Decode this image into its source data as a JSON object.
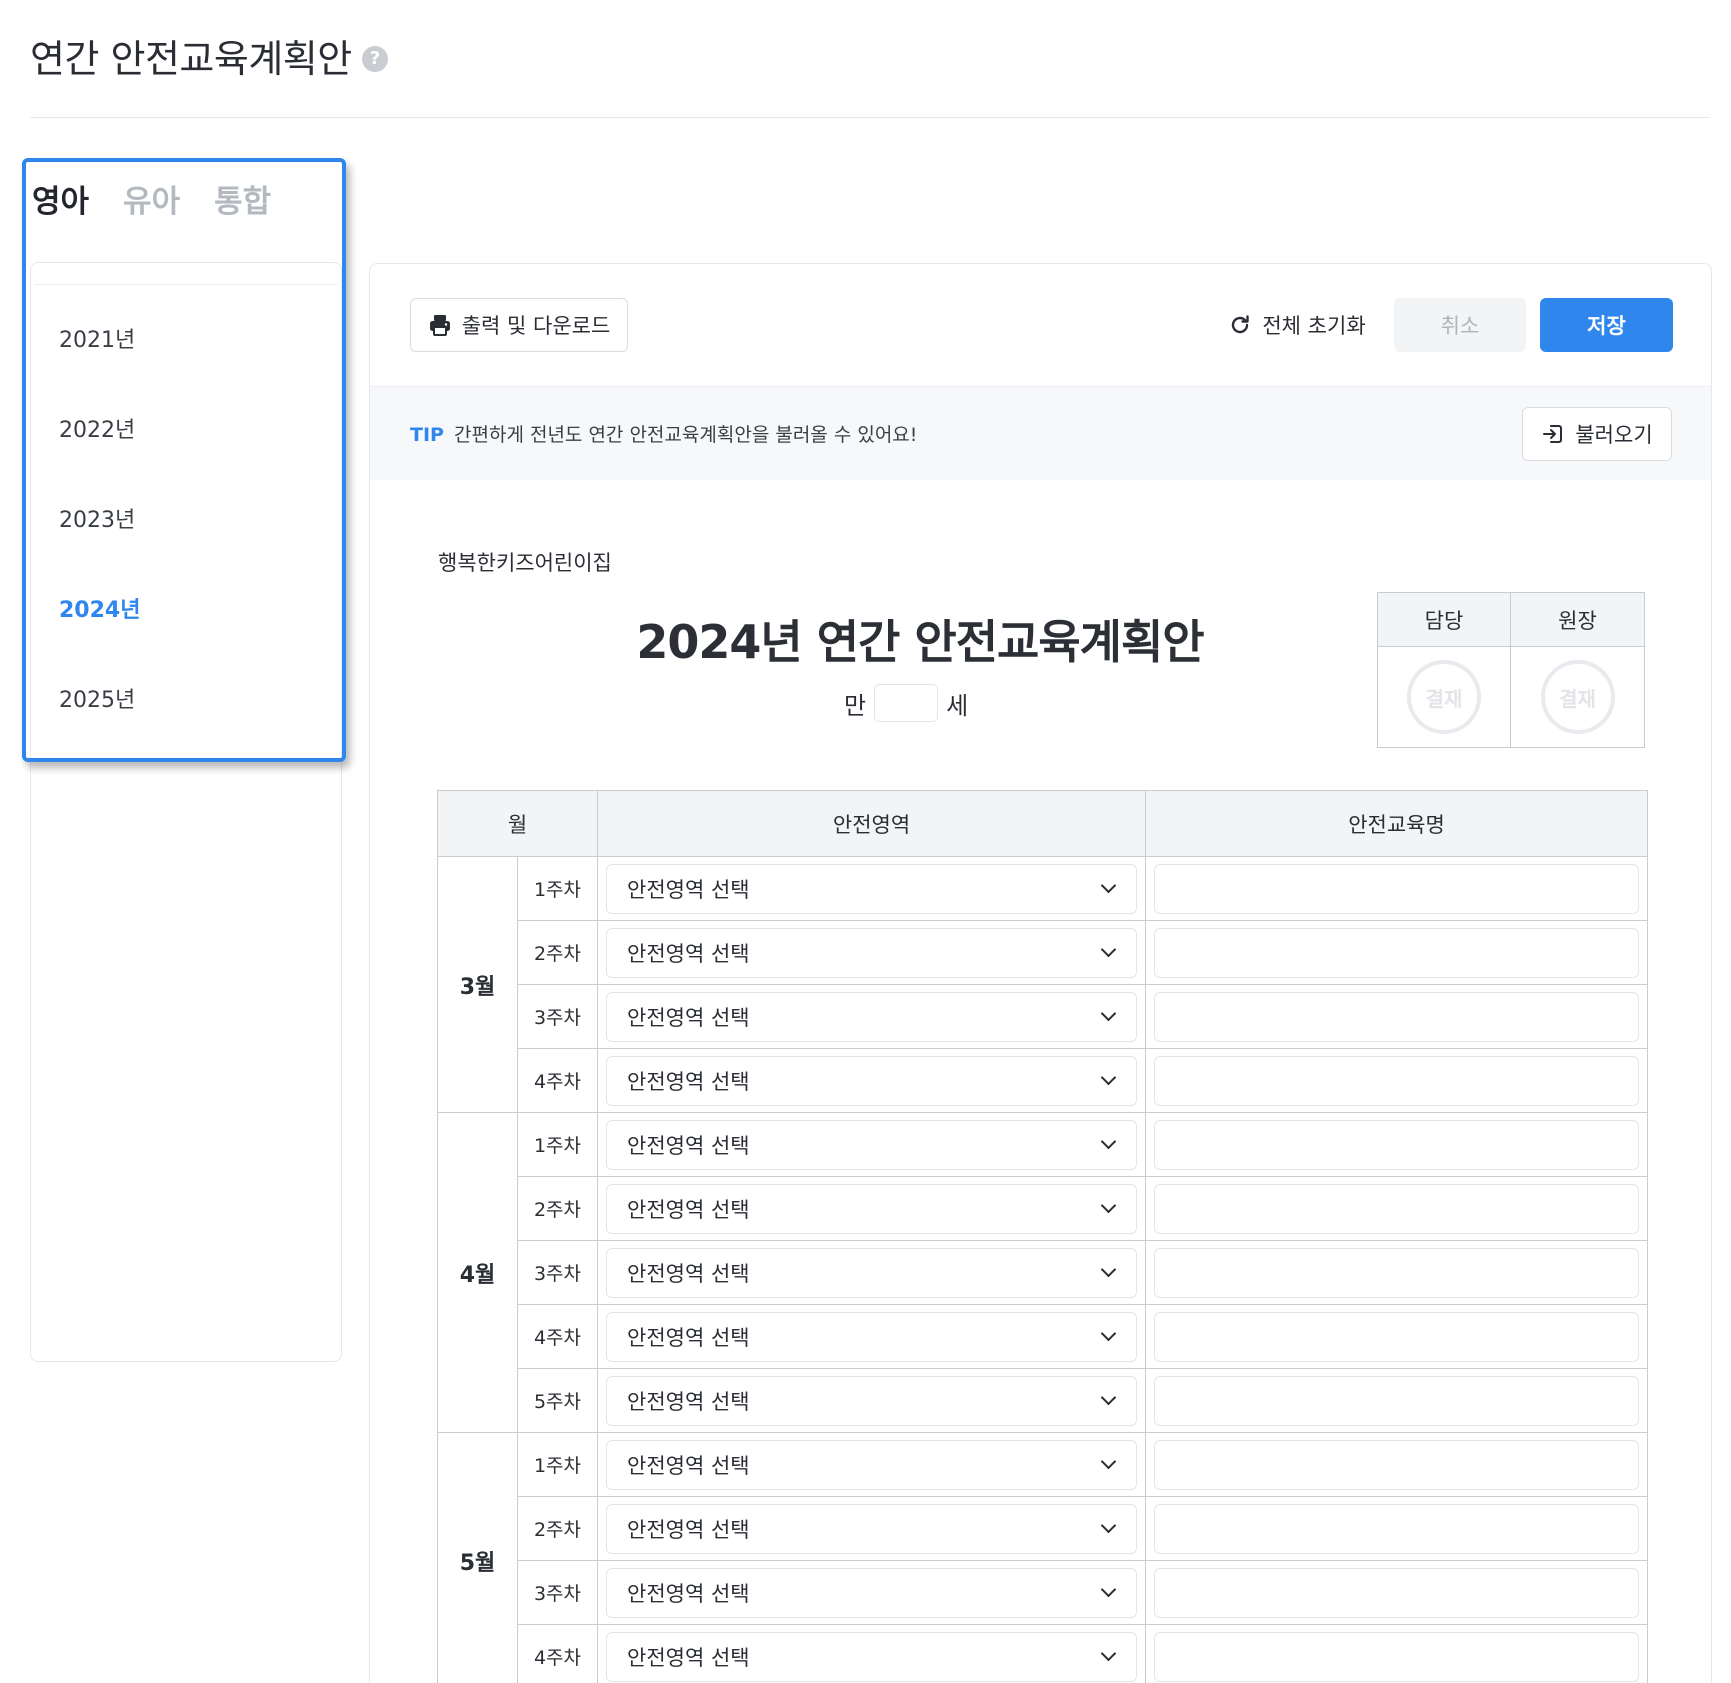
{
  "page": {
    "title": "연간 안전교육계획안",
    "help_icon": "question-circle-icon"
  },
  "tabs": [
    {
      "label": "영아",
      "active": true
    },
    {
      "label": "유아",
      "active": false
    },
    {
      "label": "통합",
      "active": false
    }
  ],
  "years": [
    {
      "label": "2021년",
      "selected": false
    },
    {
      "label": "2022년",
      "selected": false
    },
    {
      "label": "2023년",
      "selected": false
    },
    {
      "label": "2024년",
      "selected": true
    },
    {
      "label": "2025년",
      "selected": false
    }
  ],
  "toolbar": {
    "print_label": "출력 및 다운로드",
    "print_icon": "printer-icon",
    "reset_label": "전체 초기화",
    "reset_icon": "refresh-icon",
    "cancel_label": "취소",
    "save_label": "저장"
  },
  "tip": {
    "label": "TIP",
    "text": "간편하게 전년도 연간 안전교육계획안을 불러올 수 있어요!",
    "load_label": "불러오기",
    "load_icon": "import-icon"
  },
  "document": {
    "org_name": "행복한키즈어린이집",
    "title": "2024년 연간 안전교육계획안",
    "age_prefix": "만",
    "age_value": "",
    "age_suffix": "세"
  },
  "approval": {
    "headers": [
      "담당",
      "원장"
    ],
    "stamp_text": "결재"
  },
  "table": {
    "headers": {
      "month": "월",
      "area": "안전영역",
      "name": "안전교육명"
    },
    "select_placeholder": "안전영역 선택",
    "months": [
      {
        "label": "3월",
        "weeks": [
          "1주차",
          "2주차",
          "3주차",
          "4주차"
        ]
      },
      {
        "label": "4월",
        "weeks": [
          "1주차",
          "2주차",
          "3주차",
          "4주차",
          "5주차"
        ]
      },
      {
        "label": "5월",
        "weeks": [
          "1주차",
          "2주차",
          "3주차",
          "4주차"
        ]
      }
    ]
  },
  "colors": {
    "accent": "#2f86ec",
    "border": "#c9cdd2",
    "header_bg": "#f3f4f6"
  }
}
